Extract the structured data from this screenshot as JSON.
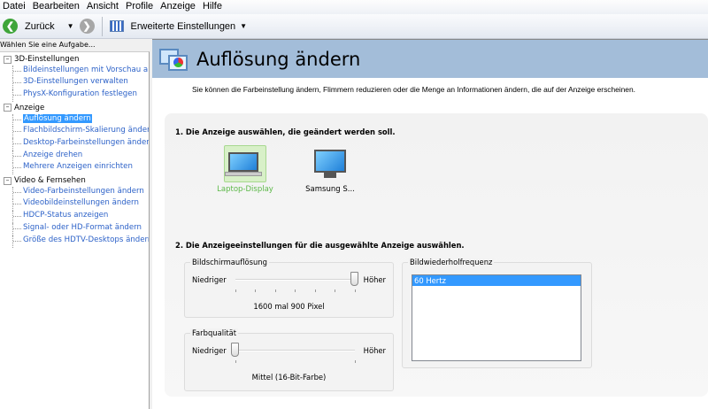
{
  "menu": [
    "Datei",
    "Bearbeiten",
    "Ansicht",
    "Profile",
    "Anzeige",
    "Hilfe"
  ],
  "toolbar": {
    "back_label": "Zurück",
    "advanced_label": "Erweiterte Einstellungen"
  },
  "sidebar": {
    "task_label": "Wählen Sie eine Aufgabe...",
    "groups": [
      {
        "label": "3D-Einstellungen",
        "items": [
          "Bildeinstellungen mit Vorschau anpassen",
          "3D-Einstellungen verwalten",
          "PhysX-Konfiguration festlegen"
        ]
      },
      {
        "label": "Anzeige",
        "items": [
          "Auflösung ändern",
          "Flachbildschirm-Skalierung ändern",
          "Desktop-Farbeinstellungen ändern",
          "Anzeige drehen",
          "Mehrere Anzeigen einrichten"
        ]
      },
      {
        "label": "Video & Fernsehen",
        "items": [
          "Video-Farbeinstellungen ändern",
          "Videobildeinstellungen ändern",
          "HDCP-Status anzeigen",
          "Signal- oder HD-Format ändern",
          "Größe des HDTV-Desktops ändern"
        ]
      }
    ],
    "selected": "Auflösung ändern"
  },
  "page": {
    "title": "Auflösung ändern",
    "description": "Sie können die Farbeinstellung ändern, Flimmern reduzieren oder die Menge an Informationen ändern, die auf der Anzeige erscheinen.",
    "step1": "1. Die Anzeige auswählen, die geändert werden soll.",
    "displays": [
      {
        "label": "Laptop-Display",
        "selected": true
      },
      {
        "label": "Samsung S...",
        "selected": false
      }
    ],
    "step2": "2. Die Anzeigeeinstellungen für die ausgewählte Anzeige auswählen.",
    "resolution": {
      "legend": "Bildschirmauflösung",
      "low": "Niedriger",
      "high": "Höher",
      "value": "1600 mal 900 Pixel",
      "ticks": 7,
      "position": 6
    },
    "color": {
      "legend": "Farbqualität",
      "low": "Niedriger",
      "high": "Höher",
      "value": "Mittel (16-Bit-Farbe)",
      "ticks": 2,
      "position": 0
    },
    "refresh": {
      "legend": "Bildwiederholfrequenz",
      "options": [
        "60 Hertz"
      ],
      "selected": "60 Hertz"
    }
  },
  "colors": {
    "header": "#a3bdd9",
    "selection": "#3399ff",
    "link": "#2d62c8",
    "selected_display": "#5cb848"
  }
}
